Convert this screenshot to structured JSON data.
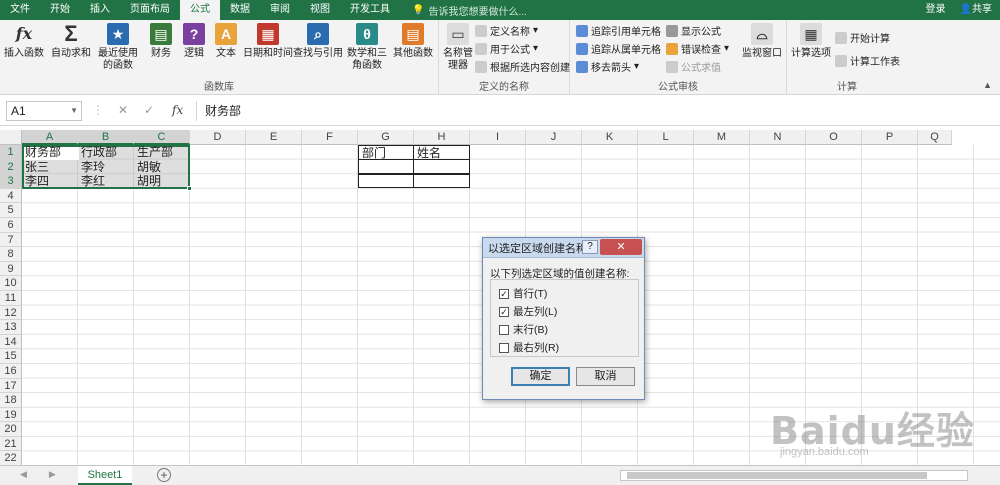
{
  "tabs": [
    "文件",
    "开始",
    "插入",
    "页面布局",
    "公式",
    "数据",
    "审阅",
    "视图",
    "开发工具"
  ],
  "active_tab": "公式",
  "tell_me": "告诉我您想要做什么...",
  "login": "登录",
  "share": "共享",
  "ribbon": {
    "function_library": {
      "label": "函数库",
      "buttons": [
        "插入函数",
        "自动求和",
        "最近使用的函数",
        "财务",
        "逻辑",
        "文本",
        "日期和时间",
        "查找与引用",
        "数学和三角函数",
        "其他函数"
      ]
    },
    "defined_names": {
      "label": "定义的名称",
      "big": "名称管理器",
      "small": [
        "定义名称",
        "用于公式",
        "根据所选内容创建"
      ]
    },
    "formula_auditing": {
      "label": "公式审核",
      "small": [
        "追踪引用单元格",
        "追踪从属单元格",
        "移去箭头",
        "显示公式",
        "错误检查",
        "公式求值"
      ],
      "big": "监视窗口"
    },
    "calculation": {
      "label": "计算",
      "big": "计算选项",
      "small": [
        "开始计算",
        "计算工作表"
      ]
    }
  },
  "formula_bar": {
    "name_box": "A1",
    "formula": "财务部"
  },
  "columns": [
    "A",
    "B",
    "C",
    "D",
    "E",
    "F",
    "G",
    "H",
    "I",
    "J",
    "K",
    "L",
    "M",
    "N",
    "O",
    "P",
    "Q"
  ],
  "rows": [
    "1",
    "2",
    "3",
    "4",
    "5",
    "6",
    "7",
    "8",
    "9",
    "10",
    "11",
    "12",
    "13",
    "14",
    "15",
    "16",
    "17",
    "18",
    "19",
    "20",
    "21",
    "22"
  ],
  "table1": {
    "headers": [
      "财务部",
      "行政部",
      "生产部"
    ],
    "row2": [
      "张三",
      "李玲",
      "胡敏"
    ],
    "row3": [
      "李四",
      "李红",
      "胡明"
    ]
  },
  "table2": {
    "headers": [
      "部门",
      "姓名"
    ]
  },
  "sheet_tab": "Sheet1",
  "dialog": {
    "title": "以选定区域创建名称",
    "help": "?",
    "close": "✕",
    "prompt": "以下列选定区域的值创建名称:",
    "options": [
      {
        "label": "首行(T)",
        "checked": true
      },
      {
        "label": "最左列(L)",
        "checked": true
      },
      {
        "label": "末行(B)",
        "checked": false
      },
      {
        "label": "最右列(R)",
        "checked": false
      }
    ],
    "ok": "确定",
    "cancel": "取消"
  },
  "watermark": {
    "brand": "Baidu经验",
    "url": "jingyan.baidu.com"
  },
  "colors": {
    "excel_green": "#217346",
    "ribbon_bg": "#f3f3f3"
  }
}
